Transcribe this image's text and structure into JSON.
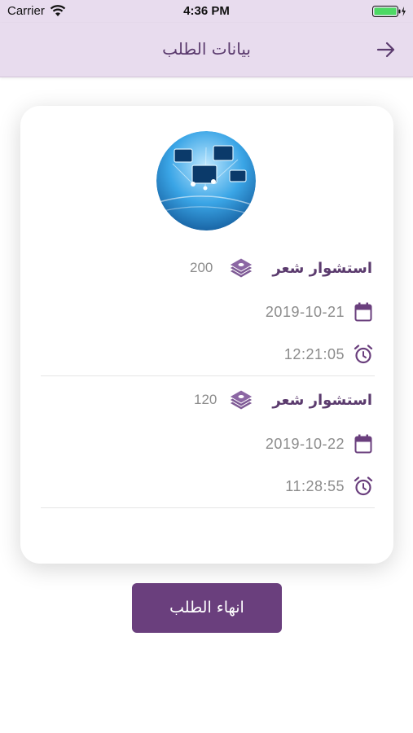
{
  "status_bar": {
    "carrier": "Carrier",
    "time": "4:36 PM"
  },
  "nav": {
    "title": "بيانات الطلب",
    "back_icon": "arrow-right-icon"
  },
  "card": {
    "avatar_icon": "network-image",
    "orders": [
      {
        "title": "استشوار شعر",
        "price": "200",
        "date": "2019-10-21",
        "time": "12:21:05"
      },
      {
        "title": "استشوار شعر",
        "price": "120",
        "date": "2019-10-22",
        "time": "11:28:55"
      }
    ]
  },
  "actions": {
    "finish_label": "انهاء الطلب"
  },
  "colors": {
    "header_bg": "#e8dcee",
    "accent": "#5b3b6e",
    "button_bg": "#6a3f7d",
    "muted_text": "#8c8c8c"
  }
}
